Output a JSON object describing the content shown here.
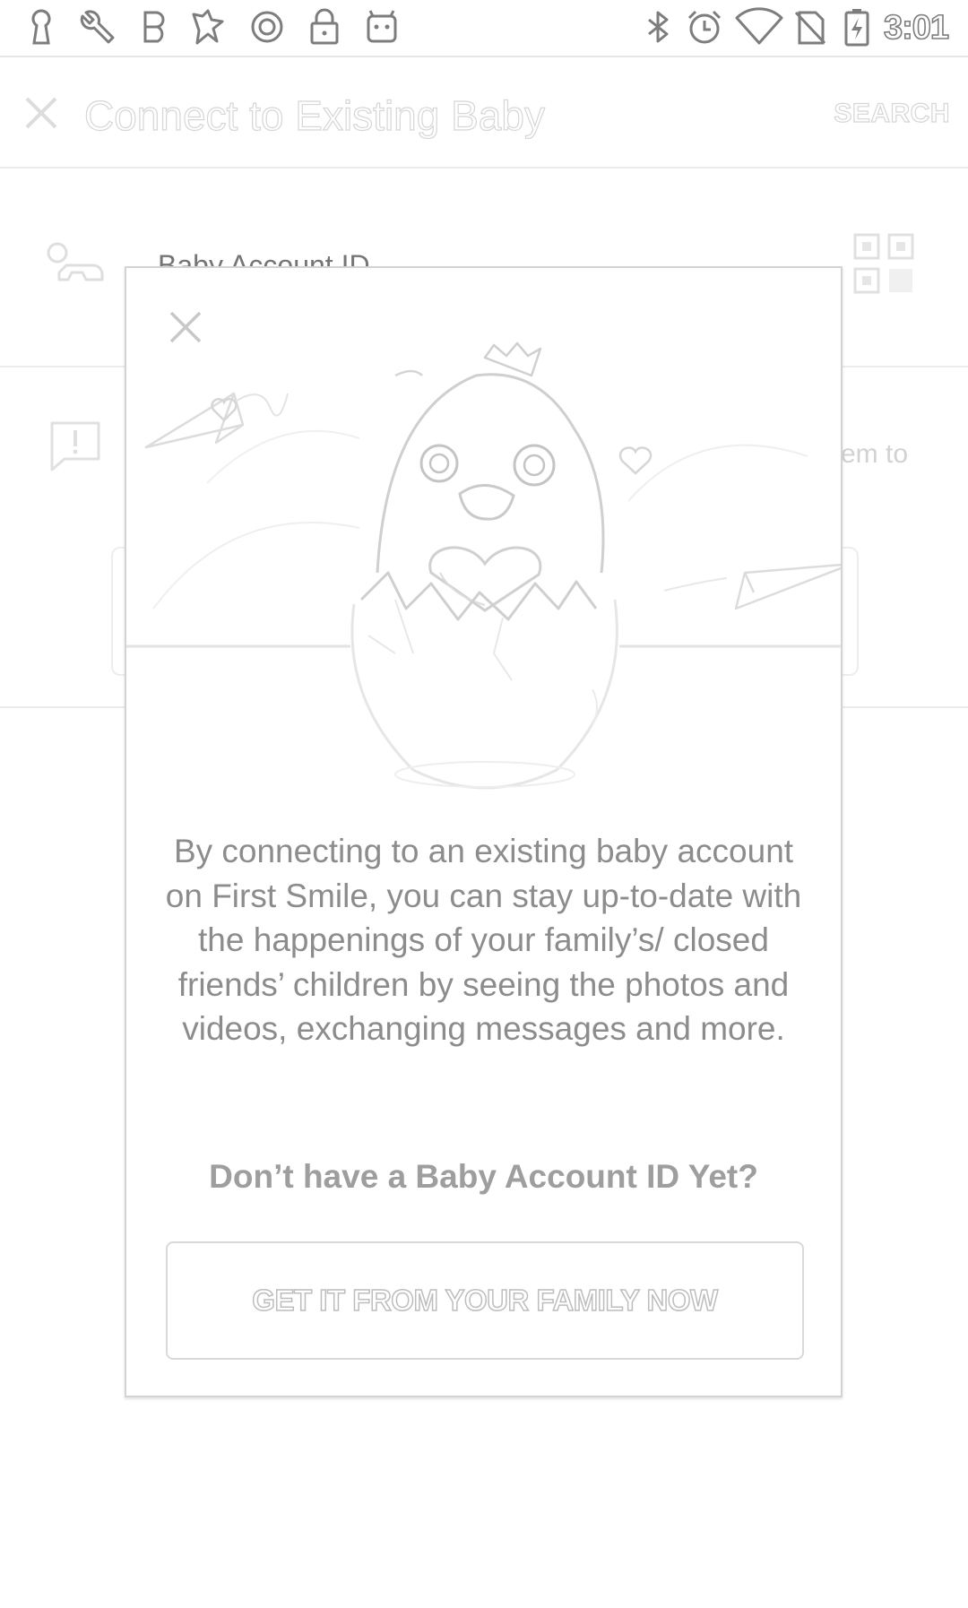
{
  "status_bar": {
    "time": "3:01",
    "left_icons": [
      "keyhole-icon",
      "wrench-icon",
      "b-badge-icon",
      "fav-icon",
      "circle-icon",
      "lock-icon",
      "android-icon"
    ],
    "right_icons": [
      "bluetooth-icon",
      "alarm-icon",
      "wifi-icon",
      "no-sim-icon",
      "battery-charging-icon"
    ]
  },
  "toolbar": {
    "title": "Connect to Existing Baby",
    "search_label": "SEARCH"
  },
  "form": {
    "account_id_placeholder": "Baby Account ID",
    "partial_text": "em to"
  },
  "dialog": {
    "body": "By connecting to an existing baby account on First Smile, you can stay up-to-date with the happenings of your family’s/ closed friends’ children by seeing the photos and videos, exchanging messages and more.",
    "question": "Don’t have a Baby Account ID Yet?",
    "button_label": "GET IT FROM YOUR FAMILY NOW"
  },
  "colors": {
    "outline": "#8a8a8a",
    "divider": "#e6e6e6",
    "dialog_border": "#d3d3d3"
  }
}
